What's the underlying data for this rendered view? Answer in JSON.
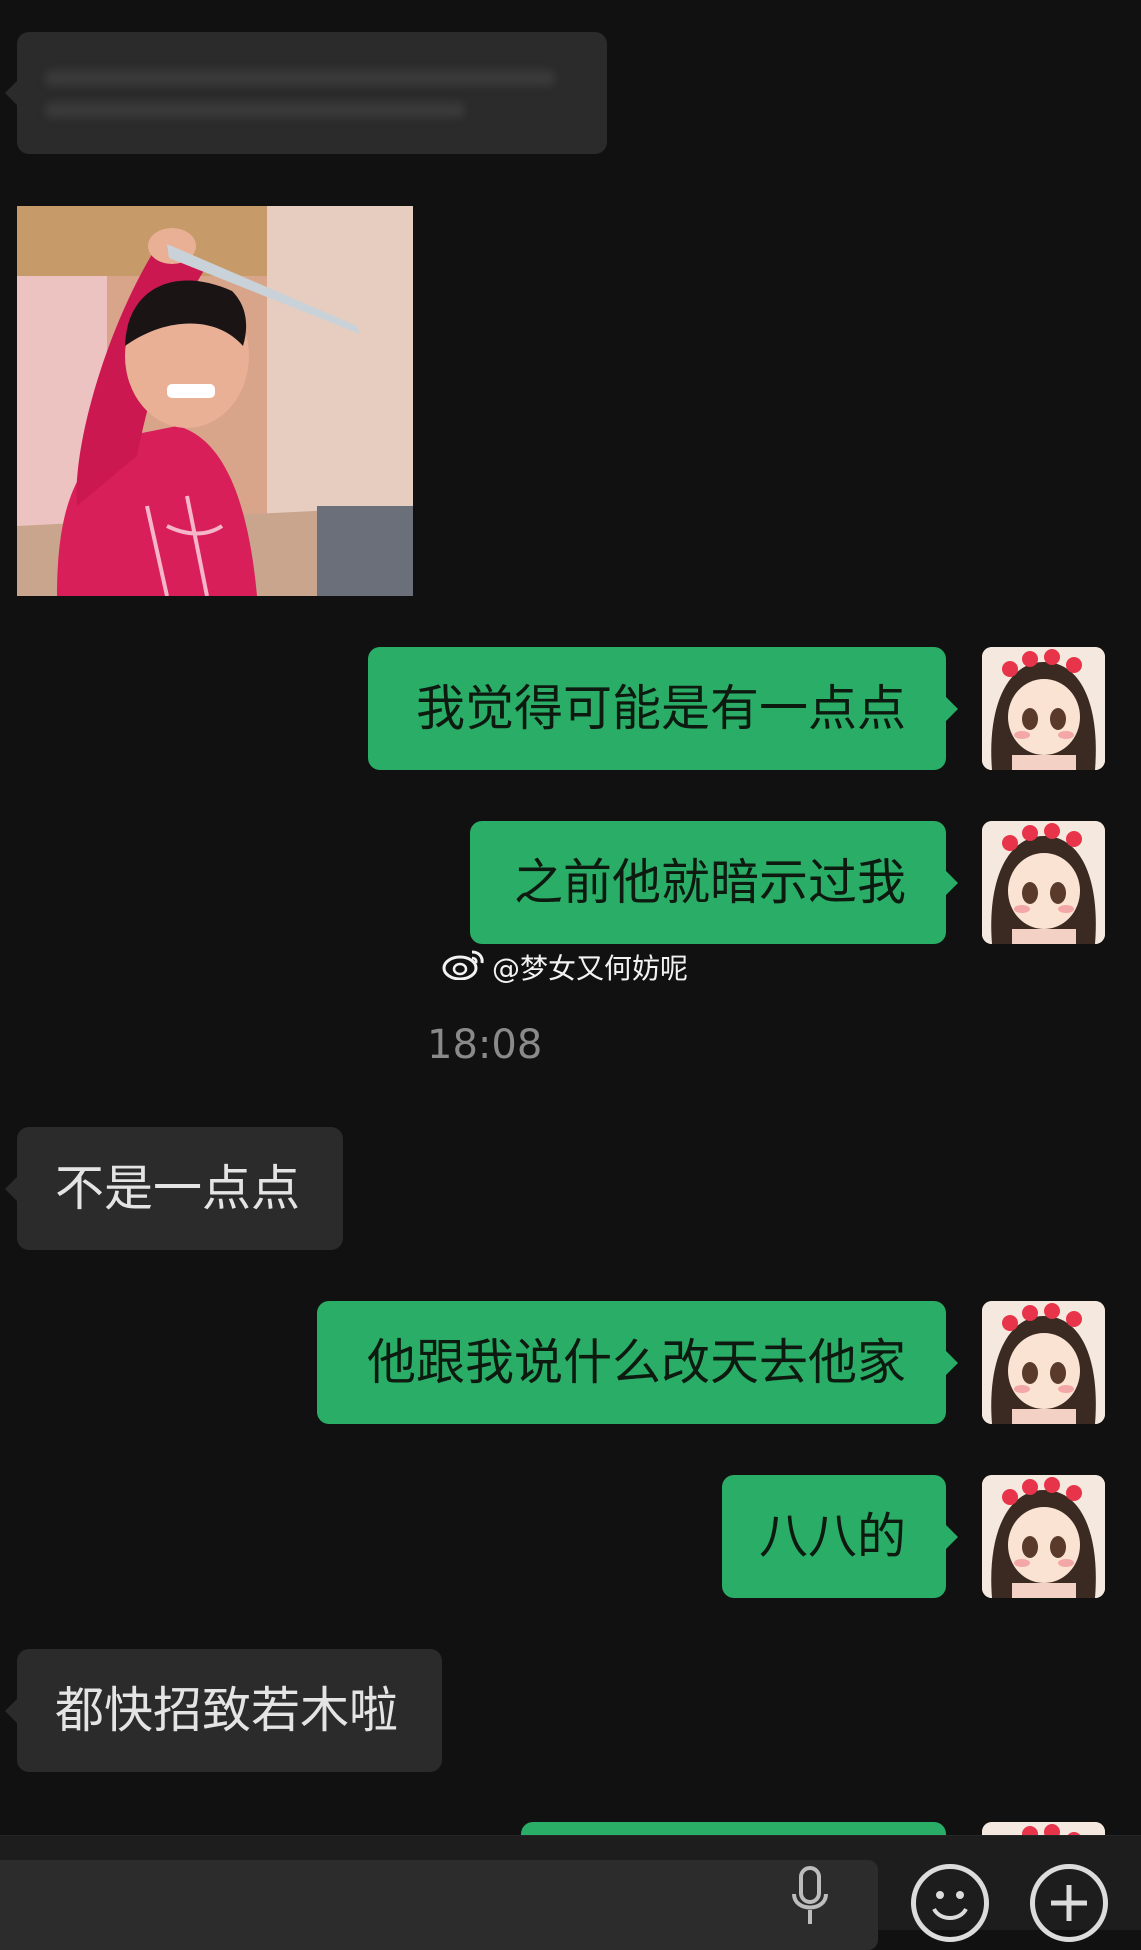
{
  "messages": [
    {
      "id": "m1",
      "side": "left",
      "text": "我觉得可能是有一点点"
    },
    {
      "id": "m2",
      "side": "right",
      "text": "之前他就暗示过我"
    },
    {
      "id": "m3",
      "side": "left",
      "text": "不是一点点"
    },
    {
      "id": "m4",
      "side": "right",
      "text": "他跟我说什么改天去他家"
    },
    {
      "id": "m5",
      "side": "right",
      "text": "八八的"
    },
    {
      "id": "m6",
      "side": "left",
      "text": "都快招致若木啦"
    }
  ],
  "timestamp": "18:08",
  "watermark": "@梦女又何妨呢",
  "colors": {
    "background": "#111111",
    "incoming_bubble": "#2b2b2b",
    "outgoing_bubble": "#2aae67",
    "timestamp_text": "#8a8a8a"
  },
  "icons": {
    "watermark_logo": "weibo-icon",
    "voice": "microphone-icon",
    "emoji": "emoji-icon",
    "more": "plus-icon"
  }
}
